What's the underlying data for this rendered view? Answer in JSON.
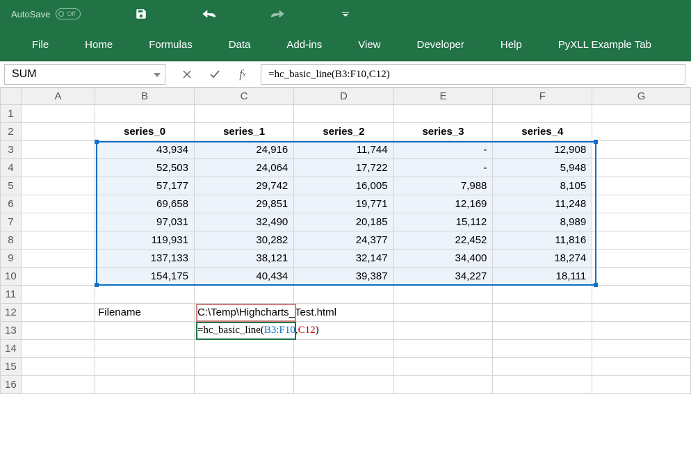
{
  "qat": {
    "autosave_label": "AutoSave",
    "autosave_state": "Off"
  },
  "tabs": [
    "File",
    "Home",
    "Formulas",
    "Data",
    "Add-ins",
    "View",
    "Developer",
    "Help",
    "PyXLL Example Tab"
  ],
  "name_box": "SUM",
  "formula_bar": "=hc_basic_line(B3:F10,C12)",
  "columns": [
    "A",
    "B",
    "C",
    "D",
    "E",
    "F",
    "G"
  ],
  "row_numbers": [
    "1",
    "2",
    "3",
    "4",
    "5",
    "6",
    "7",
    "8",
    "9",
    "10",
    "11",
    "12",
    "13",
    "14",
    "15",
    "16"
  ],
  "headers": {
    "b2": "series_0",
    "c2": "series_1",
    "d2": "series_2",
    "e2": "series_3",
    "f2": "series_4"
  },
  "data_rows": [
    {
      "b": "43,934",
      "c": "24,916",
      "d": "11,744",
      "e": "-",
      "f": "12,908"
    },
    {
      "b": "52,503",
      "c": "24,064",
      "d": "17,722",
      "e": "-",
      "f": "5,948"
    },
    {
      "b": "57,177",
      "c": "29,742",
      "d": "16,005",
      "e": "7,988",
      "f": "8,105"
    },
    {
      "b": "69,658",
      "c": "29,851",
      "d": "19,771",
      "e": "12,169",
      "f": "11,248"
    },
    {
      "b": "97,031",
      "c": "32,490",
      "d": "20,185",
      "e": "15,112",
      "f": "8,989"
    },
    {
      "b": "119,931",
      "c": "30,282",
      "d": "24,377",
      "e": "22,452",
      "f": "11,816"
    },
    {
      "b": "137,133",
      "c": "38,121",
      "d": "32,147",
      "e": "34,400",
      "f": "18,274"
    },
    {
      "b": "154,175",
      "c": "40,434",
      "d": "39,387",
      "e": "34,227",
      "f": "18,111"
    }
  ],
  "row12": {
    "b": "Filename",
    "c": "C:\\Temp\\Highcharts_Test.html"
  },
  "row13": {
    "prefix": "=hc_basic_line(",
    "arg1": "B3:F10",
    "comma": ",",
    "arg2": "C12",
    "suffix": ")"
  }
}
